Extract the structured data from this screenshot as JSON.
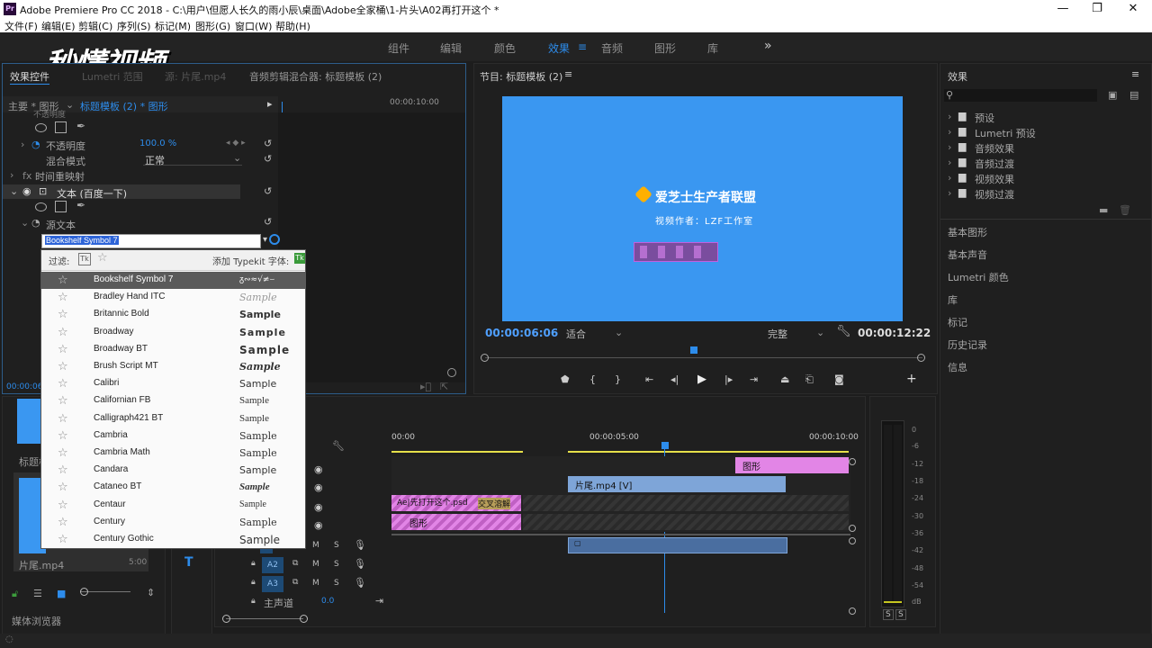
{
  "window": {
    "app_icon": "Pr",
    "title": "Adobe Premiere Pro CC 2018 - C:\\用户\\但愿人长久的雨小辰\\桌面\\Adobe全家桶\\1-片头\\A02再打开这个 *",
    "minimize": "—",
    "maximize": "❐",
    "close": "✕"
  },
  "menu": [
    "文件(F)",
    "编辑(E)",
    "剪辑(C)",
    "序列(S)",
    "标记(M)",
    "图形(G)",
    "窗口(W)",
    "帮助(H)"
  ],
  "workspaces": {
    "tabs": [
      "组件",
      "编辑",
      "颜色",
      "效果",
      "音频",
      "图形",
      "库"
    ],
    "active": "效果",
    "more": "»"
  },
  "watermark": "秒懂视频",
  "effect_controls": {
    "tabs": [
      "效果控件",
      "Lumetri 范围",
      "源: 片尾.mp4",
      "音频剪辑混合器: 标题模板 (2)"
    ],
    "breadcrumb_master": "主要 * 图形",
    "breadcrumb_seq": "标题模板 (2) * 图形",
    "timecode_ruler": "00:00:10:00",
    "opacity_prev": "不透明度",
    "opacity_label": "不透明度",
    "opacity_value": "100.0 %",
    "blend_label": "混合模式",
    "blend_value": "正常",
    "time_remap": "时间重映射",
    "text_layer": "文本 (百度一下)",
    "source_text": "源文本",
    "font_input": "Bookshelf Symbol 7",
    "bottom_timecode": "00:00:06"
  },
  "font_dropdown": {
    "filter_label": "过滤:",
    "typekit_label": "添加 Typekit 字体:",
    "fonts": [
      {
        "name": "Bookshelf Symbol 7",
        "sample": "ᵹ∾≈√≠⌣"
      },
      {
        "name": "Bradley Hand ITC",
        "sample": "Sample"
      },
      {
        "name": "Britannic Bold",
        "sample": "Sample"
      },
      {
        "name": "Broadway",
        "sample": "Sample"
      },
      {
        "name": "Broadway BT",
        "sample": "Sample"
      },
      {
        "name": "Brush Script MT",
        "sample": "Sample"
      },
      {
        "name": "Calibri",
        "sample": "Sample"
      },
      {
        "name": "Californian FB",
        "sample": "Sample"
      },
      {
        "name": "Calligraph421 BT",
        "sample": "Sample"
      },
      {
        "name": "Cambria",
        "sample": "Sample"
      },
      {
        "name": "Cambria Math",
        "sample": "Sample"
      },
      {
        "name": "Candara",
        "sample": "Sample"
      },
      {
        "name": "Cataneo BT",
        "sample": "Sample"
      },
      {
        "name": "Centaur",
        "sample": "Sample"
      },
      {
        "name": "Century",
        "sample": "Sample"
      },
      {
        "name": "Century Gothic",
        "sample": "Sample"
      }
    ]
  },
  "program_monitor": {
    "title": "节目: 标题模板 (2)",
    "logo_text": "爱芝士生产者联盟",
    "author_text": "视频作者：LZF工作室",
    "current_tc": "00:00:06:06",
    "fit": "适合",
    "quality": "完整",
    "duration_tc": "00:00:12:22"
  },
  "project": {
    "label1": "标题模",
    "clip_name": "片尾.mp4",
    "clip_duration": "5:00",
    "media_browser": "媒体浏览器"
  },
  "timeline": {
    "ruler": [
      "00:00",
      "00:00:05:00",
      "00:00:10:00"
    ],
    "clips": {
      "graphic_top": "图形",
      "video": "片尾.mp4 [V]",
      "ae": "Ae|先打开这个.psd",
      "transition": "交叉溶解",
      "graphic_bottom": "图形"
    },
    "tracks": {
      "a2": "A2",
      "a3": "A3",
      "master": "主声道",
      "master_val": "0.0",
      "m": "M",
      "s": "S"
    }
  },
  "vu_meter": {
    "labels": [
      "0",
      "-6",
      "-12",
      "-18",
      "-24",
      "-30",
      "-36",
      "-42",
      "-48",
      "-54",
      "dB"
    ],
    "solo": [
      "S",
      "S"
    ]
  },
  "effects_panel": {
    "title": "效果",
    "items": [
      "预设",
      "Lumetri 预设",
      "音频效果",
      "音频过渡",
      "视频效果",
      "视频过渡"
    ],
    "side": [
      "基本图形",
      "基本声音",
      "Lumetri 颜色",
      "库",
      "标记",
      "历史记录",
      "信息"
    ]
  }
}
